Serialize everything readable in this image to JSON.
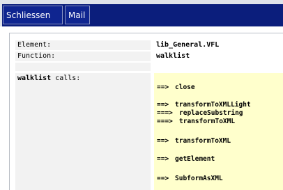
{
  "toolbar": {
    "close_label": "Schliessen",
    "mail_label": "Mail"
  },
  "details": {
    "element_label": "Element:",
    "element_value": "lib_General.VFL",
    "function_label": "Function:",
    "function_value": "walklist"
  },
  "calls": {
    "caller": "walklist",
    "caller_suffix": " calls:",
    "items": [
      {
        "arrow": "==>",
        "name": "close"
      },
      {
        "arrow": "==>",
        "name": "transformToXMLLight"
      },
      {
        "arrow": "===>",
        "name": "replaceSubstring"
      },
      {
        "arrow": "===>",
        "name": "transformToXML"
      },
      {
        "arrow": "==>",
        "name": "transformToXML"
      },
      {
        "arrow": "==>",
        "name": "getElement"
      },
      {
        "arrow": "==>",
        "name": "SubformAsXML"
      }
    ]
  },
  "colors": {
    "toolbar_bg": "#0b1e7c",
    "label_bg": "#f2f2f2",
    "calls_bg": "#ffffcc"
  }
}
